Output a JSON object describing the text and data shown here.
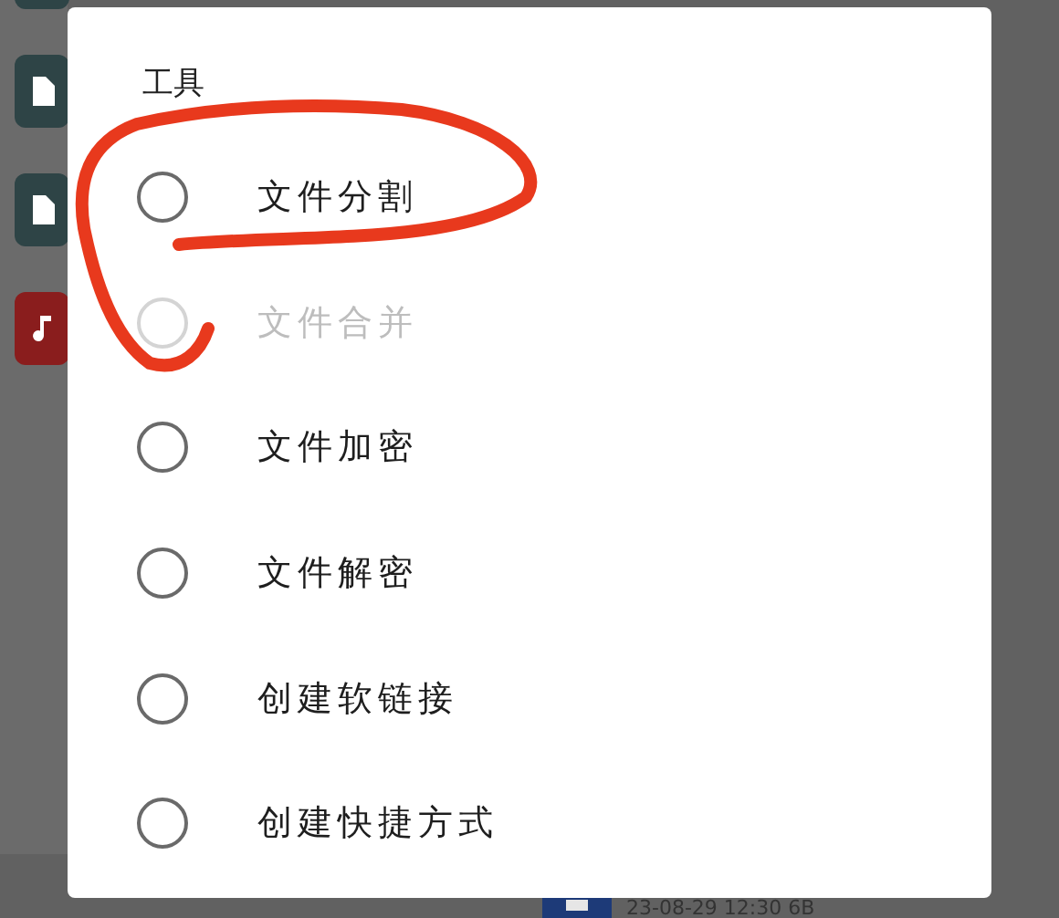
{
  "background": {
    "files": [
      {
        "kind": "cropped"
      },
      {
        "kind": "document"
      },
      {
        "kind": "document"
      },
      {
        "kind": "audio"
      }
    ],
    "bottom_item": {
      "kind": "document",
      "meta": "23-08-29 12:30 6B"
    }
  },
  "dialog": {
    "title": "工具",
    "options": [
      {
        "label": "文件分割",
        "selected": false,
        "disabled": false
      },
      {
        "label": "文件合并",
        "selected": false,
        "disabled": true
      },
      {
        "label": "文件加密",
        "selected": false,
        "disabled": false
      },
      {
        "label": "文件解密",
        "selected": false,
        "disabled": false
      },
      {
        "label": "创建软链接",
        "selected": false,
        "disabled": false
      },
      {
        "label": "创建快捷方式",
        "selected": false,
        "disabled": false
      }
    ]
  }
}
